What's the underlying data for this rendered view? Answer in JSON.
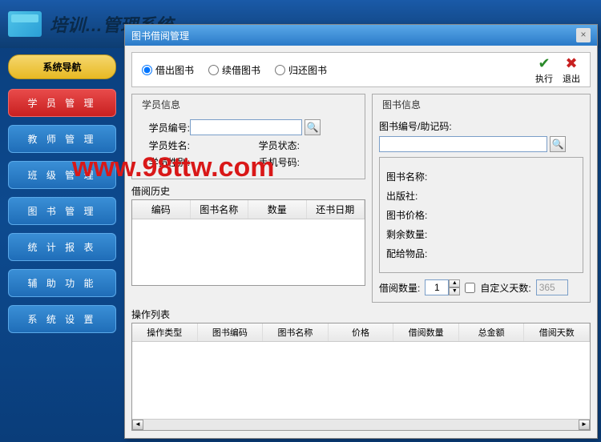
{
  "app": {
    "title": "培训…管理系统"
  },
  "dialog": {
    "title": "图书借阅管理"
  },
  "sidebar": {
    "header": "系统导航",
    "items": [
      {
        "label": "学 员 管 理",
        "active": true
      },
      {
        "label": "教 师 管 理"
      },
      {
        "label": "班 级 管 理"
      },
      {
        "label": "图 书 管 理"
      },
      {
        "label": "统 计 报 表"
      },
      {
        "label": "辅 助 功 能"
      },
      {
        "label": "系 统 设 置"
      }
    ]
  },
  "toolbar": {
    "radios": {
      "borrow": "借出图书",
      "renew": "续借图书",
      "return": "归还图书"
    },
    "execute": "执行",
    "exit": "退出"
  },
  "student": {
    "legend": "学员信息",
    "id_label": "学员编号:",
    "id_value": "",
    "name_label": "学员姓名:",
    "name_value": "",
    "status_label": "学员状态:",
    "status_value": "",
    "gender_label": "学员性别:",
    "gender_value": "",
    "phone_label": "手机号码:",
    "phone_value": ""
  },
  "history": {
    "legend": "借阅历史",
    "cols": {
      "code": "编码",
      "name": "图书名称",
      "qty": "数量",
      "return_date": "还书日期"
    }
  },
  "book": {
    "legend": "图书信息",
    "code_label": "图书编号/助记码:",
    "code_value": "",
    "name_label": "图书名称:",
    "publisher_label": "出版社:",
    "price_label": "图书价格:",
    "remain_label": "剩余数量:",
    "items_label": "配给物品:"
  },
  "borrow": {
    "qty_label": "借阅数量:",
    "qty_value": "1",
    "custom_days_label": "自定义天数:",
    "custom_days_value": "365"
  },
  "ops": {
    "legend": "操作列表",
    "cols": {
      "type": "操作类型",
      "code": "图书编码",
      "name": "图书名称",
      "price": "价格",
      "qty": "借阅数量",
      "total": "总金额",
      "days": "借阅天数"
    }
  },
  "watermark": "www.98ttw.com"
}
